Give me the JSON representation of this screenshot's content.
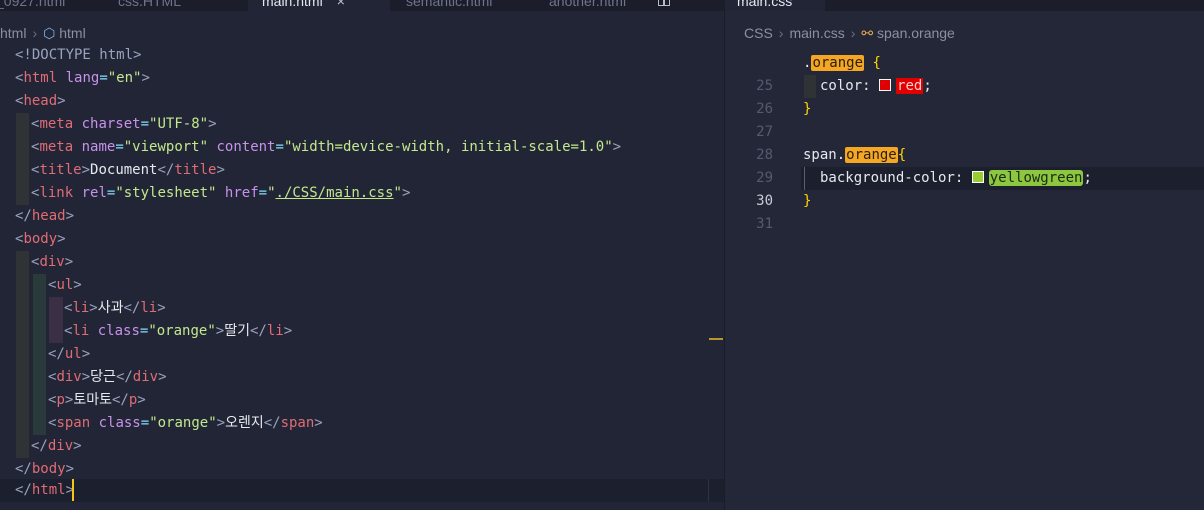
{
  "left_tabs": [
    "_0927.html",
    "css.HTML",
    "main.html",
    "semantic.html",
    "another.html"
  ],
  "left_tab_close": "×",
  "left_breadcrumb": [
    "html",
    "html"
  ],
  "right_tabs": [
    "main.css"
  ],
  "right_breadcrumb": [
    "CSS",
    "main.css",
    "span.orange"
  ],
  "html_code": {
    "doctype": "<!DOCTYPE html>",
    "lang": "\"en\"",
    "charset": "\"UTF-8\"",
    "meta_name": "\"viewport\"",
    "meta_content": "\"width=device-width, initial-scale=1.0\"",
    "title_text": "Document",
    "rel": "\"stylesheet\"",
    "href": "./CSS/main.css",
    "class_orange": "\"orange\"",
    "li1": "사과",
    "li2": "딸기",
    "div_text": "당근",
    "p_text": "토마토",
    "span_text": "오렌지"
  },
  "css_code": {
    "line_numbers": [
      "25",
      "26",
      "27",
      "28",
      "29",
      "30",
      "31"
    ],
    "active_line": "30",
    "rule1_selector": "orange",
    "rule1_property": "color:",
    "rule1_value": "red",
    "rule2_tag": "span",
    "rule2_class": "orange",
    "rule2_property": "background-color:",
    "rule2_value": "yellowgreen"
  },
  "colors": {
    "red_swatch": "#e00000",
    "yellowgreen_swatch": "#9acd32",
    "orange_highlight": "#f5a623"
  }
}
